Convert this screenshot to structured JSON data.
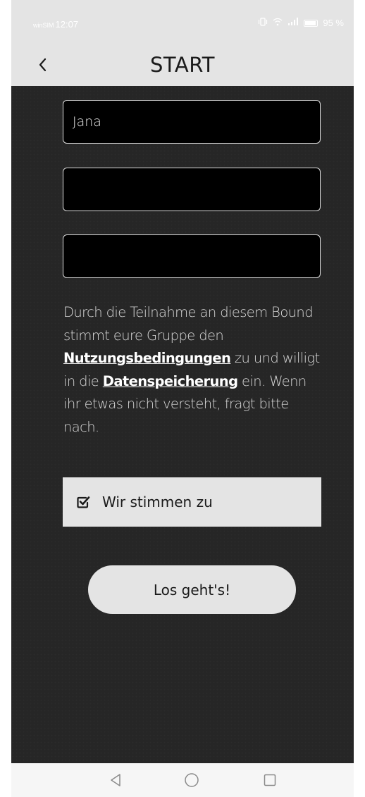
{
  "status_bar": {
    "carrier": "winSIM",
    "time": "12:07",
    "battery": "95 %",
    "icons": [
      "vibrate-icon",
      "wifi-icon",
      "signal-icon",
      "battery-icon"
    ]
  },
  "header": {
    "title": "START",
    "back_icon": "chevron-left-icon"
  },
  "form": {
    "fields": [
      {
        "value": "Jana",
        "placeholder": ""
      },
      {
        "value": "",
        "placeholder": ""
      },
      {
        "value": "",
        "placeholder": ""
      }
    ]
  },
  "consent": {
    "text_1": "Durch die Teilnahme an diesem Bound stimmt eure Gruppe den ",
    "terms_link": "Nutzungsbedingungen",
    "text_2": " zu und willigt in die ",
    "privacy_link": "Datenspeicherung",
    "text_3": " ein. Wenn ihr etwas nicht versteht, fragt bitte nach."
  },
  "agree": {
    "label": "Wir stimmen zu",
    "checked": true,
    "icon": "checked-box-icon"
  },
  "start_button": {
    "label": "Los geht's!"
  },
  "system_nav": {
    "buttons": [
      "back-triangle-icon",
      "home-circle-icon",
      "recents-square-icon"
    ]
  },
  "colors": {
    "background": "#262626",
    "bar": "#e4e4e4",
    "field": "#000000",
    "text": "#d9d9d9"
  }
}
